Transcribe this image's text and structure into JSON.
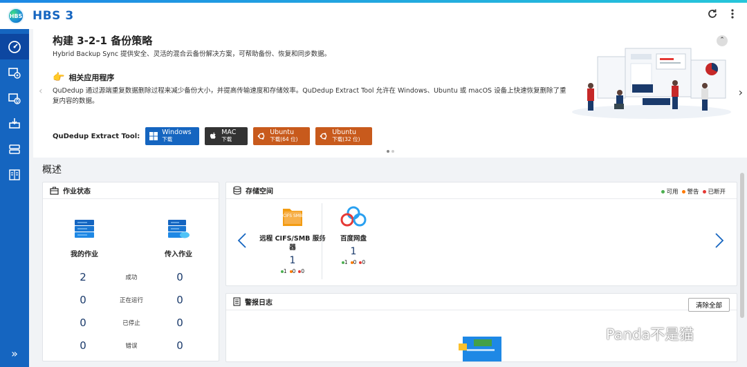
{
  "app": {
    "title": "HBS 3",
    "logo_text": "HBS"
  },
  "titlebar": {
    "refresh_icon": "refresh-icon",
    "more_icon": "more-vertical-icon"
  },
  "sidebar": {
    "items": [
      {
        "icon": "dashboard-icon",
        "active": true
      },
      {
        "icon": "backup-icon"
      },
      {
        "icon": "sync-icon"
      },
      {
        "icon": "restore-icon"
      },
      {
        "icon": "storage-icon"
      },
      {
        "icon": "logs-icon"
      }
    ],
    "expand_glyph": "»"
  },
  "banner": {
    "title": "构建 3-2-1 备份策略",
    "subtitle": "Hybrid Backup Sync 提供安全、灵活的混合云备份解决方案，可帮助备份、恢复和同步数据。",
    "related_title": "相关应用程序",
    "description": "QuDedup 通过源端重复数据删除过程来减少备份大小，并提高传输速度和存储效率。QuDedup Extract Tool 允许在 Windows、Ubuntu 或 macOS 设备上快速恢复删除了重复内容的数据。",
    "extract_label": "QuDedup Extract Tool:",
    "buttons": [
      {
        "os": "Windows",
        "sub": "下载",
        "color": "#1565c0"
      },
      {
        "os": "MAC",
        "sub": "下载",
        "color": "#333333"
      },
      {
        "os": "Ubuntu",
        "sub": "下载(64 位)",
        "color": "#c85a1c"
      },
      {
        "os": "Ubuntu",
        "sub": "下载(32 位)",
        "color": "#c85a1c"
      }
    ],
    "page_dots": 2,
    "current_page": 1
  },
  "overview": {
    "title": "概述",
    "job_status": {
      "title": "作业状态",
      "col1_title": "我的作业",
      "col2_title": "传入作业",
      "rows": [
        {
          "label": "成功",
          "mine": "2",
          "incoming": "0"
        },
        {
          "label": "正在运行",
          "mine": "0",
          "incoming": "0"
        },
        {
          "label": "已停止",
          "mine": "0",
          "incoming": "0"
        },
        {
          "label": "错误",
          "mine": "0",
          "incoming": "0"
        }
      ]
    },
    "storage": {
      "title": "存储空间",
      "legend": [
        {
          "label": "可用",
          "color": "#4caf50"
        },
        {
          "label": "警告",
          "color": "#ff7a00"
        },
        {
          "label": "已断开",
          "color": "#e53935"
        }
      ],
      "items": [
        {
          "name": "远程 CIFS/SMB 服务器",
          "count": "1",
          "ok": "1",
          "warn": "0",
          "err": "0",
          "icon": "cifs-smb-folder-icon",
          "icon_text": "CIFS SMB"
        },
        {
          "name": "百度网盘",
          "count": "1",
          "ok": "1",
          "warn": "0",
          "err": "0",
          "icon": "baidu-netdisk-icon"
        }
      ]
    },
    "alerts": {
      "title": "警报日志",
      "clear_label": "清除全部"
    }
  },
  "watermark": "Panda不是猫",
  "colors": {
    "primary": "#1565c0",
    "sidebar": "#1565c0",
    "accent": "#1a3a6b"
  }
}
